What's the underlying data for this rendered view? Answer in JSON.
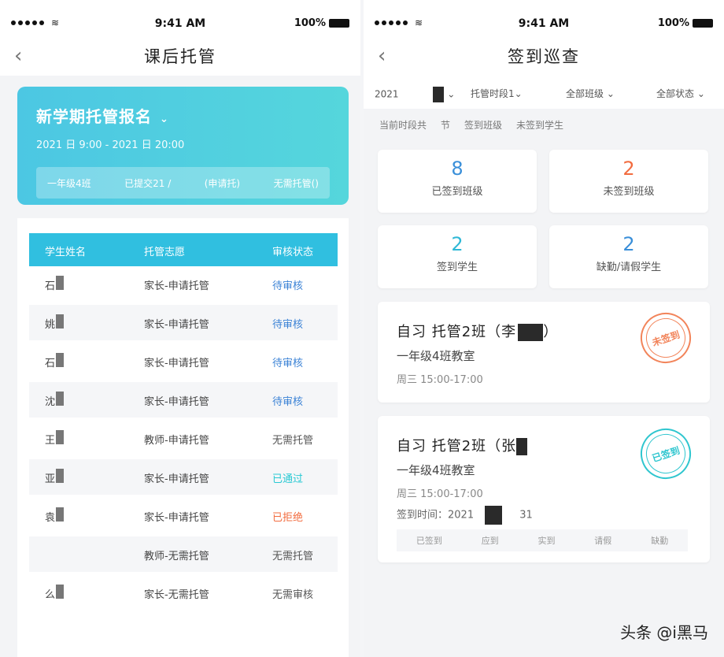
{
  "status_bar": {
    "time": "9:41 AM",
    "battery": "100%"
  },
  "left": {
    "title": "课后托管",
    "banner": {
      "title": "新学期托管报名",
      "dates": "2021    日 9:00 - 2021        日 20:00",
      "stats": [
        "一年级4班",
        "已提交21 /",
        "(申请托)",
        "无需托管()"
      ]
    },
    "table": {
      "headers": [
        "学生姓名",
        "托管志愿",
        "审核状态"
      ],
      "rows": [
        {
          "name": "石",
          "intent": "家长-申请托管",
          "status": "待审核"
        },
        {
          "name": "姚",
          "intent": "家长-申请托管",
          "status": "待审核"
        },
        {
          "name": "石",
          "intent": "家长-申请托管",
          "status": "待审核"
        },
        {
          "name": "沈",
          "intent": "家长-申请托管",
          "status": "待审核"
        },
        {
          "name": "王",
          "intent": "教师-申请托管",
          "status": "无需托管"
        },
        {
          "name": "亚",
          "intent": "家长-申请托管",
          "status": "已通过"
        },
        {
          "name": "袁",
          "intent": "家长-申请托管",
          "status": "已拒绝"
        },
        {
          "name": "",
          "intent": "教师-无需托管",
          "status": "无需托管"
        },
        {
          "name": "么",
          "intent": "家长-无需托管",
          "status": "无需审核"
        }
      ]
    }
  },
  "right": {
    "title": "签到巡查",
    "filters": [
      "2021",
      "托管时段1",
      "全部班级",
      "全部状态"
    ],
    "subtabs": [
      "当前时段共",
      "节",
      "签到班级",
      "未签到学生"
    ],
    "stats": [
      {
        "value": "8",
        "label": "已签到班级",
        "color": "#3a8fd9"
      },
      {
        "value": "2",
        "label": "未签到班级",
        "color": "#f26c3f"
      },
      {
        "value": "2",
        "label": "签到学生",
        "color": "#2fb8d6"
      },
      {
        "value": "2",
        "label": "缺勤/请假学生",
        "color": "#3a8fd9"
      }
    ],
    "cards": [
      {
        "title": "自习   托管2班（李",
        "room": "一年级4班教室",
        "time": "周三  15:00-17:00",
        "stamp": "未签到"
      },
      {
        "title": "自习   托管2班（张",
        "room": "一年级4班教室",
        "time": "周三  15:00-17:00",
        "sign_label": "签到时间：2021",
        "sign_tail": "31",
        "bar": [
          "已签到",
          "应到",
          "实到",
          "请假",
          "缺勤"
        ],
        "stamp": "已签到"
      }
    ]
  },
  "watermark": "头条 @i黑马"
}
